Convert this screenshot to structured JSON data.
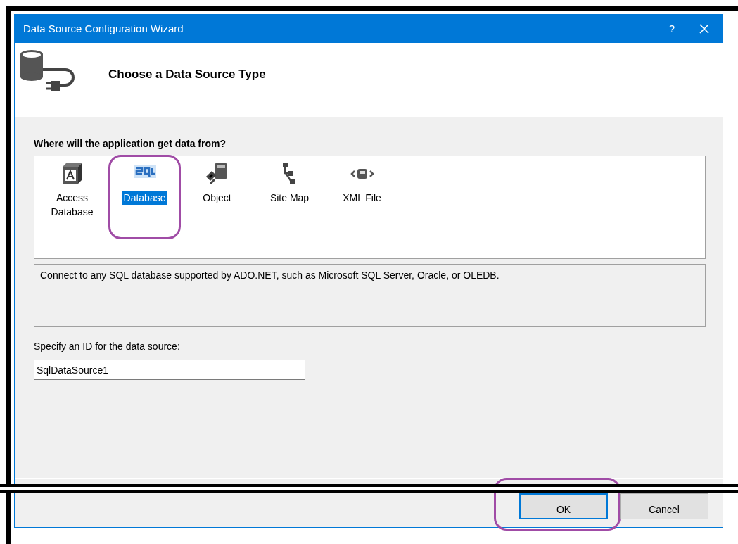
{
  "window": {
    "title": "Data Source Configuration Wizard",
    "help": "?"
  },
  "header": {
    "title": "Choose a Data Source Type"
  },
  "source_types": {
    "label": "Where will the application get data from?",
    "items": [
      {
        "label": "Access Database",
        "kind": "access",
        "selected": false,
        "highlighted": false
      },
      {
        "label": "Database",
        "kind": "sql",
        "selected": true,
        "highlighted": true
      },
      {
        "label": "Object",
        "kind": "object",
        "selected": false,
        "highlighted": false
      },
      {
        "label": "Site Map",
        "kind": "sitemap",
        "selected": false,
        "highlighted": false
      },
      {
        "label": "XML File",
        "kind": "xml",
        "selected": false,
        "highlighted": false
      }
    ]
  },
  "description": "Connect to any SQL database supported by ADO.NET, such as Microsoft SQL Server, Oracle, or OLEDB.",
  "id_field": {
    "label": "Specify an ID for the data source:",
    "value": "SqlDataSource1"
  },
  "buttons": [
    {
      "label": "OK",
      "default": true,
      "highlighted": true
    },
    {
      "label": "Cancel",
      "default": false,
      "highlighted": false
    }
  ]
}
